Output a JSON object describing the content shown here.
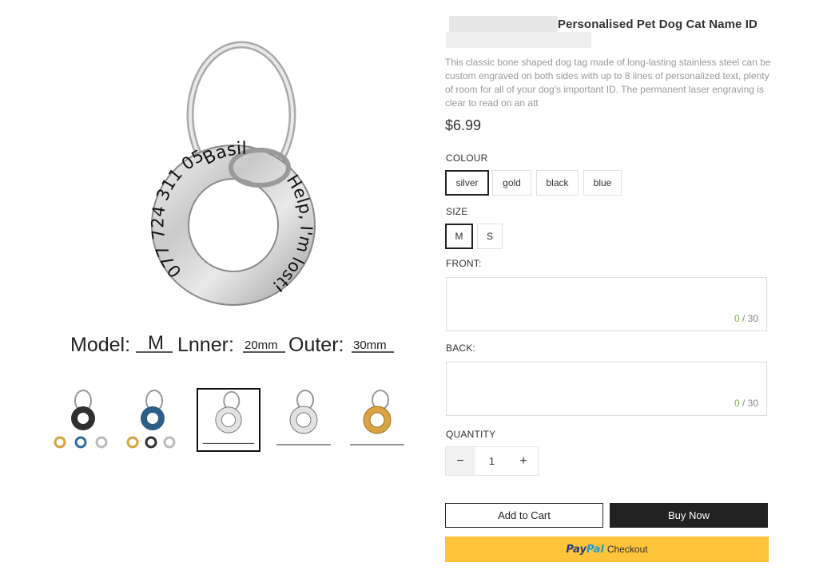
{
  "product": {
    "title": "Personalised Pet Dog Cat Name ID",
    "description": "This classic bone shaped dog tag made of long-lasting stainless steel can be custom engraved on both sides with up to 8 lines of personalized text, plenty of room for all of your dog's important ID. The permanent laser engraving is clear to read on an att",
    "price": "$6.99"
  },
  "main_image": {
    "tag_text_left": "077 724 311 05",
    "tag_text_name": "Basil",
    "tag_text_right": "Help, I'm lost!",
    "caption_model_label": "Model:",
    "caption_model_value": "M",
    "caption_inner_label": "Lnner:",
    "caption_inner_value": "20mm",
    "caption_outer_label": "Outer:",
    "caption_outer_value": "30mm"
  },
  "thumbnails": [
    {
      "variant": "black",
      "selected": false
    },
    {
      "variant": "blue",
      "selected": false
    },
    {
      "variant": "silver",
      "selected": true
    },
    {
      "variant": "silver",
      "selected": false
    },
    {
      "variant": "gold",
      "selected": false
    }
  ],
  "options": {
    "colour_label": "COLOUR",
    "colours": [
      "silver",
      "gold",
      "black",
      "blue"
    ],
    "selected_colour": "silver",
    "size_label": "SIZE",
    "sizes": [
      "M",
      "S"
    ],
    "selected_size": "M"
  },
  "engraving": {
    "front_label": "FRONT:",
    "front_count": "0",
    "front_max": "/ 30",
    "back_label": "BACK:",
    "back_count": "0",
    "back_max": "/ 30"
  },
  "quantity": {
    "label": "QUANTITY",
    "value": "1",
    "minus": "−",
    "plus": "+"
  },
  "actions": {
    "add_to_cart": "Add to Cart",
    "buy_now": "Buy Now",
    "paypal_logo_1": "Pay",
    "paypal_logo_2": "Pal",
    "paypal_text": "Checkout"
  },
  "colors": {
    "paypal_yellow": "#ffc439",
    "primary_dark": "#222222",
    "counter_green": "#7cb342"
  },
  "icons": {
    "main": "ring-tag-image",
    "thumb": "tag-thumbnail"
  }
}
